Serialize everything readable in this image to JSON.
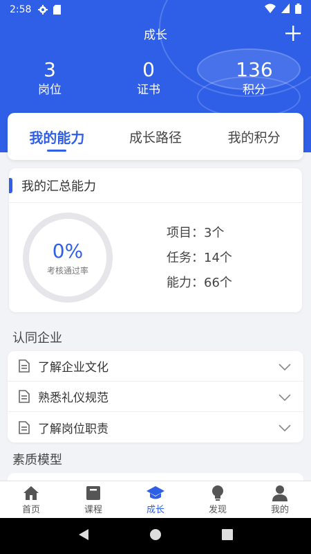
{
  "status_bar": {
    "time": "2:58"
  },
  "header": {
    "title": "成长"
  },
  "stats": [
    {
      "value": "3",
      "label": "岗位"
    },
    {
      "value": "0",
      "label": "证书"
    },
    {
      "value": "136",
      "label": "积分"
    }
  ],
  "tabs": [
    {
      "label": "我的能力",
      "active": true
    },
    {
      "label": "成长路径",
      "active": false
    },
    {
      "label": "我的积分",
      "active": false
    }
  ],
  "summary": {
    "title": "我的汇总能力",
    "percent": "0%",
    "caption": "考核通过率",
    "metrics": [
      "项目：3个",
      "任务：14个",
      "能力：66个"
    ]
  },
  "sections": [
    {
      "title": "认同企业",
      "items": [
        "了解企业文化",
        "熟悉礼仪规范",
        "了解岗位职责"
      ]
    },
    {
      "title": "素质模型"
    }
  ],
  "bottom_nav": [
    {
      "label": "首页",
      "icon": "home-icon"
    },
    {
      "label": "课程",
      "icon": "book-icon"
    },
    {
      "label": "成长",
      "icon": "graduation-cap-icon",
      "active": true
    },
    {
      "label": "发现",
      "icon": "lightbulb-icon"
    },
    {
      "label": "我的",
      "icon": "person-icon"
    }
  ],
  "colors": {
    "primary": "#2f5fe6",
    "background": "#f2f3f7"
  }
}
